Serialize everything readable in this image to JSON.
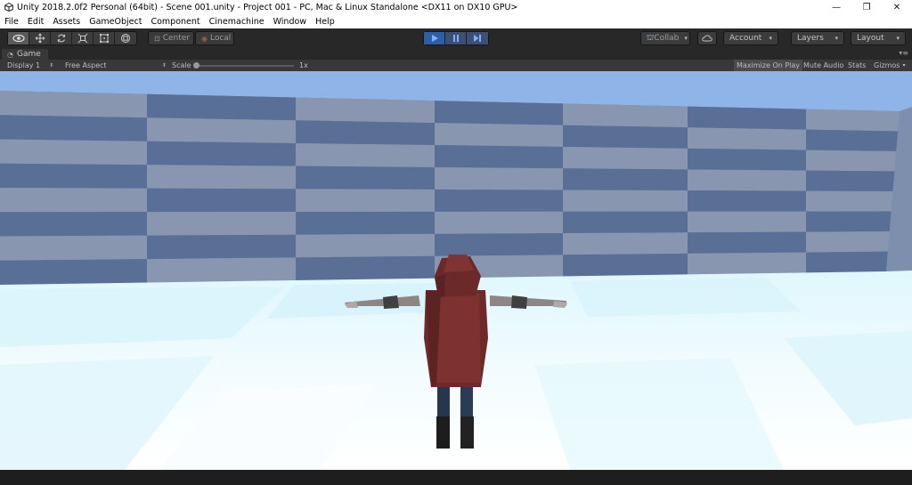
{
  "titlebar": {
    "title": "Unity 2018.2.0f2 Personal (64bit) - Scene 001.unity - Project 001 - PC, Mac & Linux Standalone <DX11 on DX10 GPU>",
    "minimize": "—",
    "maximize": "❐",
    "close": "✕"
  },
  "menu": [
    "File",
    "Edit",
    "Assets",
    "GameObject",
    "Component",
    "Cinemachine",
    "Window",
    "Help"
  ],
  "toolbar": {
    "pivot_label": "Center",
    "space_label": "Local",
    "collab_label": "Collab",
    "account_label": "Account",
    "layers_label": "Layers",
    "layout_label": "Layout",
    "play_active_color": "#2b5fa8"
  },
  "game_tab": {
    "label": "Game"
  },
  "game_bar": {
    "display": "Display 1",
    "aspect": "Free Aspect",
    "scale_label": "Scale",
    "scale_value": "1x",
    "scale_fraction": 0.0,
    "maximize_on_play": "Maximize On Play",
    "mute_audio": "Mute Audio",
    "stats": "Stats",
    "gizmos": "Gizmos"
  },
  "scene_colors": {
    "sky": "#8fb5e8",
    "wall_dark": "#5a6f96",
    "wall_light": "#8896b0",
    "floor_light": "#f4fcff",
    "floor_tint": "#d2f3fb",
    "cloak": "#7a2e2e",
    "skin": "#9a9090"
  }
}
